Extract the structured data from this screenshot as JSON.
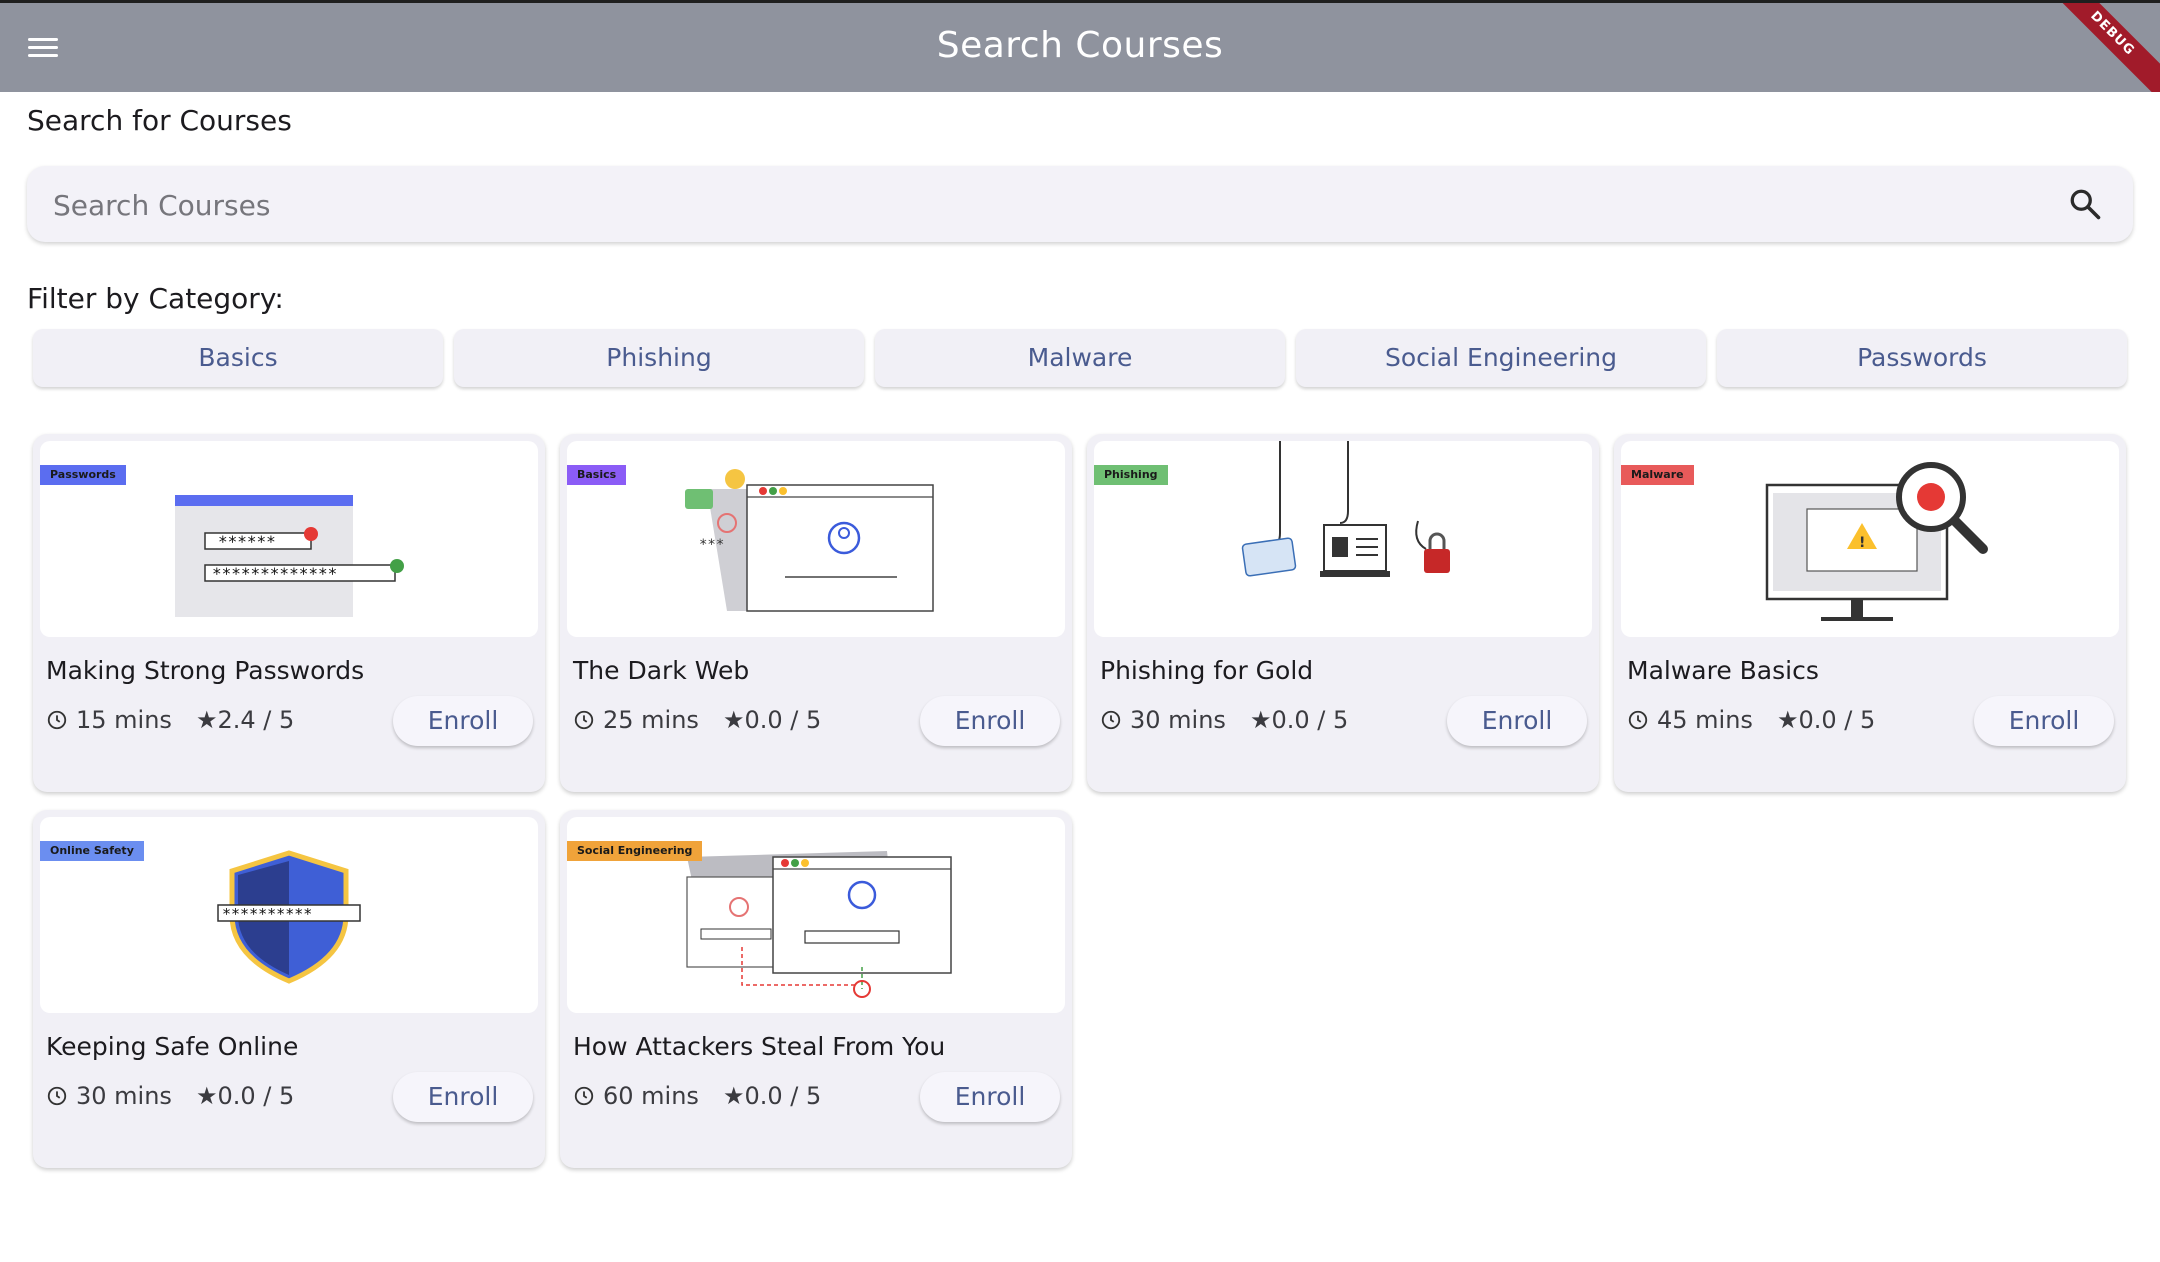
{
  "appbar": {
    "title": "Search Courses",
    "debug_label": "DEBUG"
  },
  "search": {
    "section_label": "Search for Courses",
    "placeholder": "Search Courses",
    "value": ""
  },
  "filter": {
    "label": "Filter by Category:",
    "chips": [
      "Basics",
      "Phishing",
      "Malware",
      "Social Engineering",
      "Passwords"
    ]
  },
  "courses": [
    {
      "tag": "Passwords",
      "tag_color": "#5b6df0",
      "title": "Making Strong Passwords",
      "duration": "15 mins",
      "rating": "★2.4 / 5",
      "enroll": "Enroll",
      "illustration": "password-fields-illustration"
    },
    {
      "tag": "Basics",
      "tag_color": "#8b5cf6",
      "title": "The Dark Web",
      "duration": "25 mins",
      "rating": "★0.0 / 5",
      "enroll": "Enroll",
      "illustration": "browser-login-illustration"
    },
    {
      "tag": "Phishing",
      "tag_color": "#6fbf73",
      "title": "Phishing for Gold",
      "duration": "30 mins",
      "rating": "★0.0 / 5",
      "enroll": "Enroll",
      "illustration": "fishing-hooks-illustration"
    },
    {
      "tag": "Malware",
      "tag_color": "#e85a5a",
      "title": "Malware Basics",
      "duration": "45 mins",
      "rating": "★0.0 / 5",
      "enroll": "Enroll",
      "illustration": "monitor-bug-magnifier-illustration"
    },
    {
      "tag": "Online Safety",
      "tag_color": "#6b8ef0",
      "title": "Keeping Safe Online",
      "duration": "30 mins",
      "rating": "★0.0 / 5",
      "enroll": "Enroll",
      "illustration": "shield-password-illustration"
    },
    {
      "tag": "Social Engineering",
      "tag_color": "#f0a33a",
      "title": "How Attackers Steal From You",
      "duration": "60 mins",
      "rating": "★0.0 / 5",
      "enroll": "Enroll",
      "illustration": "attacker-intercept-illustration"
    }
  ]
}
